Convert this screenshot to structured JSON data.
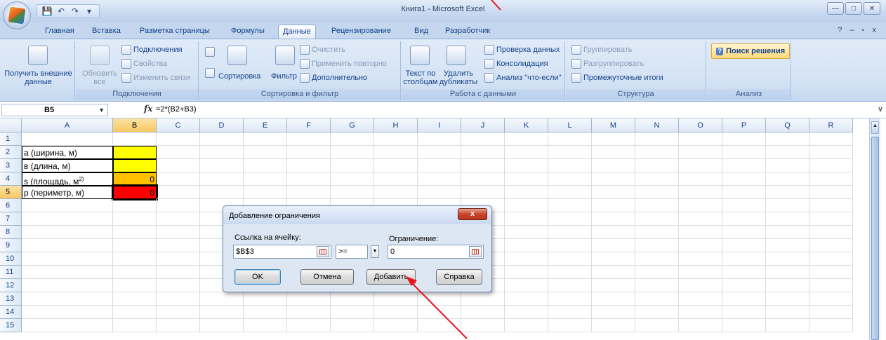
{
  "window": {
    "title": "Книга1 - Microsoft Excel"
  },
  "tabs": [
    {
      "label": "Главная"
    },
    {
      "label": "Вставка"
    },
    {
      "label": "Разметка страницы"
    },
    {
      "label": "Формулы"
    },
    {
      "label": "Данные",
      "active": true
    },
    {
      "label": "Рецензирование"
    },
    {
      "label": "Вид"
    },
    {
      "label": "Разработчик"
    }
  ],
  "ribbon": {
    "get_external": "Получить внешние данные",
    "connections": {
      "refresh_all": "Обновить все",
      "connections": "Подключения",
      "properties": "Свойства",
      "edit_links": "Изменить связи",
      "group": "Подключения"
    },
    "sort_filter": {
      "sort": "Сортировка",
      "filter": "Фильтр",
      "clear": "Очистить",
      "reapply": "Применить повторно",
      "advanced": "Дополнительно",
      "group": "Сортировка и фильтр"
    },
    "data_tools": {
      "text_to_columns": "Текст по столбцам",
      "remove_dups": "Удалить дубликаты",
      "validation": "Проверка данных",
      "consolidate": "Консолидация",
      "what_if": "Анализ \"что-если\"",
      "group": "Работа с данными"
    },
    "outline": {
      "group_btn": "Группировать",
      "ungroup": "Разгруппировать",
      "subtotal": "Промежуточные итоги",
      "group": "Структура"
    },
    "analysis": {
      "solver": "Поиск решения",
      "group": "Анализ"
    }
  },
  "formula_bar": {
    "name_box": "B5",
    "fx": "fx",
    "formula": "=2*(B2+B3)"
  },
  "columns": [
    "A",
    "B",
    "C",
    "D",
    "E",
    "F",
    "G",
    "H",
    "I",
    "J",
    "K",
    "L",
    "M",
    "N",
    "O",
    "P",
    "Q",
    "R"
  ],
  "rows": [
    "1",
    "2",
    "3",
    "4",
    "5",
    "6",
    "7",
    "8",
    "9",
    "10",
    "11",
    "12",
    "13",
    "14",
    "15"
  ],
  "cells": {
    "A2": "а (ширина, м)",
    "A3": "в (длина, м)",
    "A4": "s (площадь, м",
    "A4_sup": "2)",
    "A5": "р (периметр, м)",
    "B4": "0",
    "B5": "0"
  },
  "colors": {
    "B2": "#ffff00",
    "B3": "#ffff00",
    "B4": "#ffc000",
    "B5": "#ff0000",
    "annotation": "#e8141b"
  },
  "dialog": {
    "title": "Добавление ограничения",
    "close": "x",
    "cell_ref_label": "Ссылка на ячейку:",
    "cell_ref_value": "$B$3",
    "operator": ">=",
    "constraint_label": "Ограничение:",
    "constraint_value": "0",
    "ok": "OK",
    "cancel": "Отмена",
    "add": "Добавить",
    "help": "Справка"
  }
}
